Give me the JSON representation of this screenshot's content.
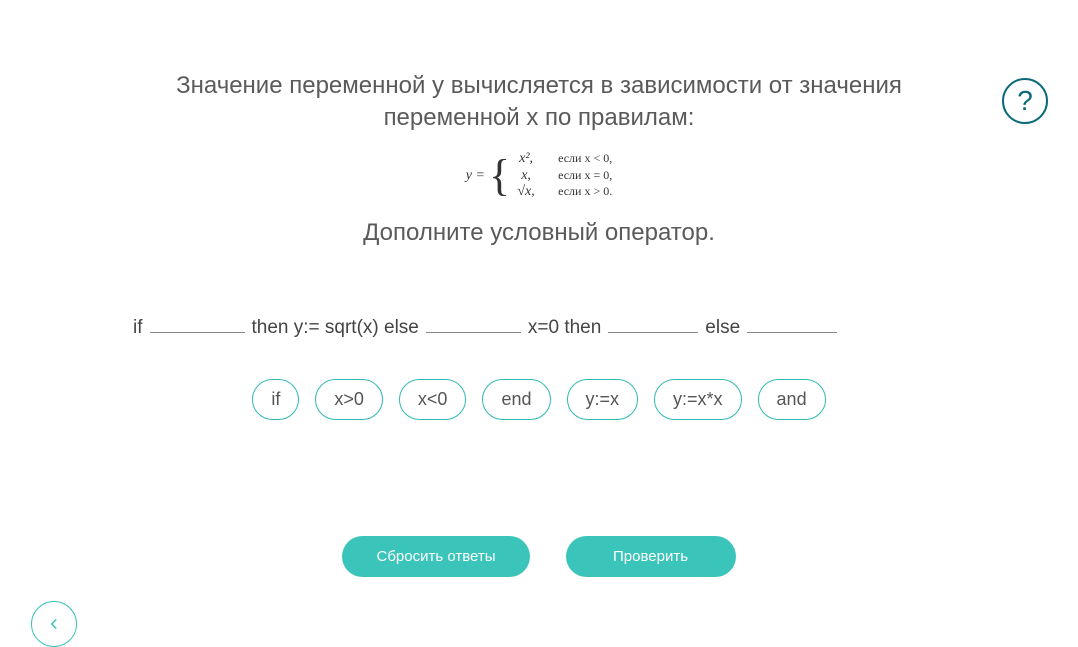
{
  "help_tooltip": "?",
  "question": {
    "title_line1": "Значение переменной y вычисляется в зависимости от значения",
    "title_line2": "переменной x по правилам:",
    "instruction": "Дополните условный оператор."
  },
  "formula": {
    "prefix": "y =",
    "case1_expr": "x²,",
    "case1_cond": "если x < 0,",
    "case2_expr": "x,",
    "case2_cond": "если x = 0,",
    "case3_expr": "√x,",
    "case3_cond": "если x > 0."
  },
  "fill": {
    "t1": "if",
    "t2": "then y:= sqrt(x) else",
    "t3": "x=0 then",
    "t4": "else"
  },
  "options": [
    "if",
    "x>0",
    "x<0",
    "end",
    "y:=x",
    "y:=x*x",
    "and"
  ],
  "buttons": {
    "reset": "Сбросить ответы",
    "check": "Проверить"
  }
}
